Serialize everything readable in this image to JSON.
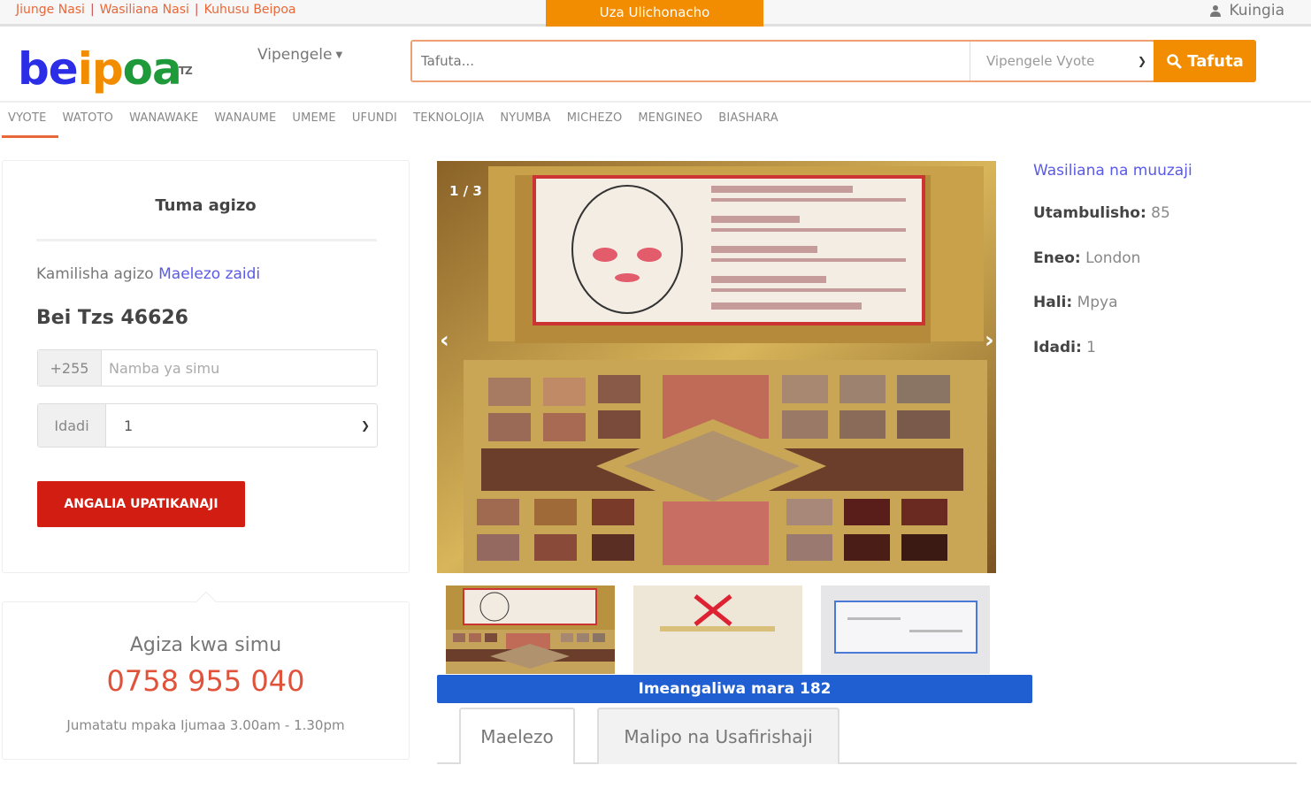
{
  "topbar": {
    "links": [
      "Jiunge Nasi",
      "Wasiliana Nasi",
      "Kuhusu Beipoa"
    ],
    "sell_label": "Uza Ulichonacho",
    "login_label": "Kuingia"
  },
  "brand": {
    "part1": "be",
    "part2": "ip",
    "part3": "oa",
    "suffix": "TZ"
  },
  "header": {
    "features_label": "Vipengele",
    "search_placeholder": "Tafuta...",
    "category_selected": "Vipengele Vyote",
    "search_button": "Tafuta"
  },
  "categories": [
    "VYOTE",
    "WATOTO",
    "WANAWAKE",
    "WANAUME",
    "UMEME",
    "UFUNDI",
    "TEKNOLOJIA",
    "NYUMBA",
    "MICHEZO",
    "MENGINEO",
    "BIASHARA"
  ],
  "order": {
    "title": "Tuma agizo",
    "complete_text": "Kamilisha agizo",
    "more_info": "Maelezo zaidi",
    "price": "Bei Tzs 46626",
    "phone_prefix": "+255",
    "phone_placeholder": "Namba ya simu",
    "qty_label": "Idadi",
    "qty_value": "1",
    "check_button": "ANGALIA UPATIKANAJI"
  },
  "call": {
    "heading": "Agiza kwa simu",
    "phone": "0758 955 040",
    "hours": "Jumatatu mpaka Ijumaa 3.00am - 1.30pm"
  },
  "gallery": {
    "counter": "1 / 3",
    "views_prefix": "Imeangaliwa mara",
    "views_count": "182"
  },
  "tabs": [
    "Maelezo",
    "Malipo na Usafirishaji"
  ],
  "seller": {
    "contact": "Wasiliana na muuzaji",
    "id_label": "Utambulisho:",
    "id_value": "85",
    "area_label": "Eneo:",
    "area_value": "London",
    "cond_label": "Hali:",
    "cond_value": "Mpya",
    "qty_label": "Idadi:",
    "qty_value": "1"
  },
  "colors": {
    "accent": "#f28c00",
    "link": "#5a5ae8",
    "cta": "#d21e12",
    "views_bar": "#1f5fd1"
  }
}
